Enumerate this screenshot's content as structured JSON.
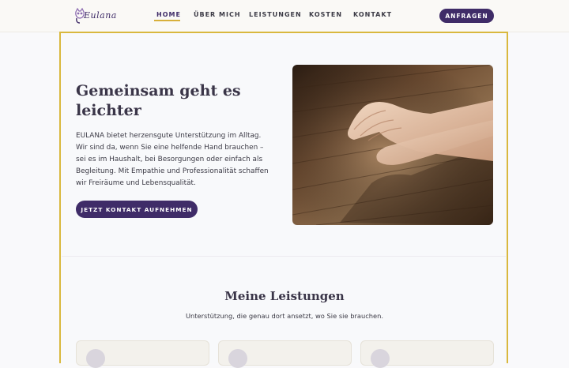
{
  "brand": {
    "logo_text": "Eulana"
  },
  "nav": {
    "items": [
      {
        "label": "HOME",
        "active": true
      },
      {
        "label": "ÜBER MICH",
        "active": false
      },
      {
        "label": "LEISTUNGEN",
        "active": false
      },
      {
        "label": "KOSTEN",
        "active": false
      },
      {
        "label": "KONTAKT",
        "active": false
      }
    ],
    "cta_label": "ANFRAGEN"
  },
  "hero": {
    "title_line1": "Gemeinsam geht es",
    "title_line2": "leichter",
    "text_lines": [
      "EULANA bietet herzensgute Unterstützung im Alltag.",
      "Wir sind da, wenn Sie eine helfende Hand brauchen –",
      "sei es im Haushalt, bei Besorgungen oder einfach als",
      "Begleitung. Mit Empathie und Professionalität schaffen",
      "wir Freiräume und Lebensqualität."
    ],
    "button_label": "JETZT KONTAKT AUFNEHMEN"
  },
  "services": {
    "title": "Meine Leistungen",
    "subtitle": "Unterstützung, die genau dort ansetzt, wo Sie sie brauchen."
  },
  "colors": {
    "accent": "#3f2c68",
    "frame": "#d9b83e",
    "background": "#f8f9fb"
  }
}
